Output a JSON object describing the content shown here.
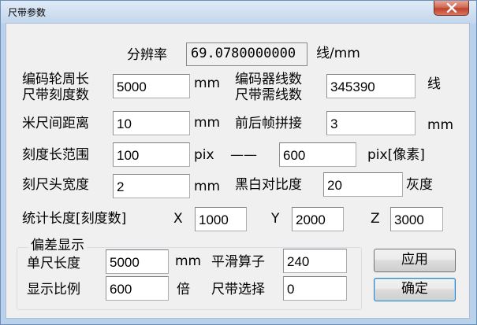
{
  "window": {
    "title": "尺带参数"
  },
  "resolution": {
    "label": "分辨率",
    "value": "69.0780000000",
    "unit": "线/mm"
  },
  "fields": {
    "encoder_len_label": "编码轮周长\n尺带刻度数",
    "encoder_len_value": "5000",
    "encoder_len_unit": "mm",
    "encoder_lines_label": "编码器线数\n尺带需线数",
    "encoder_lines_value": "345390",
    "encoder_lines_unit": "线",
    "meter_spacing_label": "米尺间距离",
    "meter_spacing_value": "10",
    "meter_spacing_unit": "mm",
    "frame_stitch_label": "前后帧拼接",
    "frame_stitch_value": "3",
    "frame_stitch_unit": "mm",
    "scale_range_label": "刻度长范围",
    "scale_range_min": "100",
    "scale_range_unit_min": "pix",
    "scale_range_sep": "——",
    "scale_range_max": "600",
    "scale_range_unit_max": "pix[像素]",
    "head_width_label": "刻尺头宽度",
    "head_width_value": "2",
    "head_width_unit": "mm",
    "contrast_label": "黑白对比度",
    "contrast_value": "20",
    "contrast_unit": "灰度",
    "stat_len_label": "统计长度[刻度数]",
    "x_label": "X",
    "x_value": "1000",
    "y_label": "Y",
    "y_value": "2000",
    "z_label": "Z",
    "z_value": "3000"
  },
  "deviation": {
    "title": "偏差显示",
    "single_len_label": "单尺长度",
    "single_len_value": "5000",
    "single_len_unit": "mm",
    "smooth_label": "平滑算子",
    "smooth_value": "240",
    "display_ratio_label": "显示比例",
    "display_ratio_value": "600",
    "display_ratio_unit": "倍",
    "tape_select_label": "尺带选择",
    "tape_select_value": "0"
  },
  "buttons": {
    "apply": "应用",
    "ok": "确定"
  }
}
